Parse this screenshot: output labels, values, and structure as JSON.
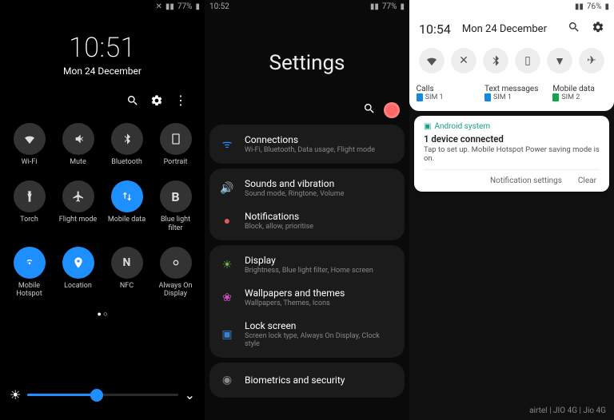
{
  "p1": {
    "status_time": "",
    "status_battery": "77%",
    "time": "10:51",
    "date": "Mon 24 December",
    "tiles": [
      {
        "label": "Wi-Fi",
        "active": false
      },
      {
        "label": "Mute",
        "active": false
      },
      {
        "label": "Bluetooth",
        "active": false
      },
      {
        "label": "Portrait",
        "active": false
      },
      {
        "label": "Torch",
        "active": false
      },
      {
        "label": "Flight mode",
        "active": false
      },
      {
        "label": "Mobile data",
        "active": true
      },
      {
        "label": "Blue light filter",
        "active": false
      },
      {
        "label": "Mobile Hotspot",
        "active": true
      },
      {
        "label": "Location",
        "active": true
      },
      {
        "label": "NFC",
        "active": false
      },
      {
        "label": "Always On Display",
        "active": false
      }
    ],
    "pages": "●  ○"
  },
  "p2": {
    "status_time": "10:52",
    "status_battery": "77%",
    "title": "Settings",
    "groups": [
      [
        {
          "title": "Connections",
          "sub": "Wi-Fi, Bluetooth, Data usage, Flight mode",
          "icon": "wifi",
          "color": "#1e8fff"
        }
      ],
      [
        {
          "title": "Sounds and vibration",
          "sub": "Sound mode, Ringtone, Volume",
          "icon": "sound",
          "color": "#a04fe2"
        },
        {
          "title": "Notifications",
          "sub": "Block, allow, prioritise",
          "icon": "bell",
          "color": "#e05a5a"
        }
      ],
      [
        {
          "title": "Display",
          "sub": "Brightness, Blue light filter, Home screen",
          "icon": "display",
          "color": "#6db84c"
        },
        {
          "title": "Wallpapers and themes",
          "sub": "Wallpapers, Themes, Icons",
          "icon": "theme",
          "color": "#d04fc2"
        },
        {
          "title": "Lock screen",
          "sub": "Screen lock type, Always On Display, Clock style",
          "icon": "lock",
          "color": "#3a7fd0"
        }
      ],
      [
        {
          "title": "Biometrics and security",
          "sub": "",
          "icon": "security",
          "color": "#888"
        }
      ]
    ]
  },
  "p3": {
    "status_battery": "76%",
    "time": "10:54",
    "date": "Mon 24 December",
    "sim": [
      {
        "title": "Calls",
        "label": "SIM 1",
        "color": "blue"
      },
      {
        "title": "Text messages",
        "label": "SIM 1",
        "color": "blue"
      },
      {
        "title": "Mobile data",
        "label": "SIM 2",
        "color": "green"
      }
    ],
    "notif": {
      "app": "Android system",
      "title": "1 device connected",
      "body": "Tap to set up. Mobile Hotspot Power saving mode is on."
    },
    "actions": {
      "settings": "Notification settings",
      "clear": "Clear"
    },
    "carrier": "airtel | JIO 4G | Jio 4G"
  }
}
